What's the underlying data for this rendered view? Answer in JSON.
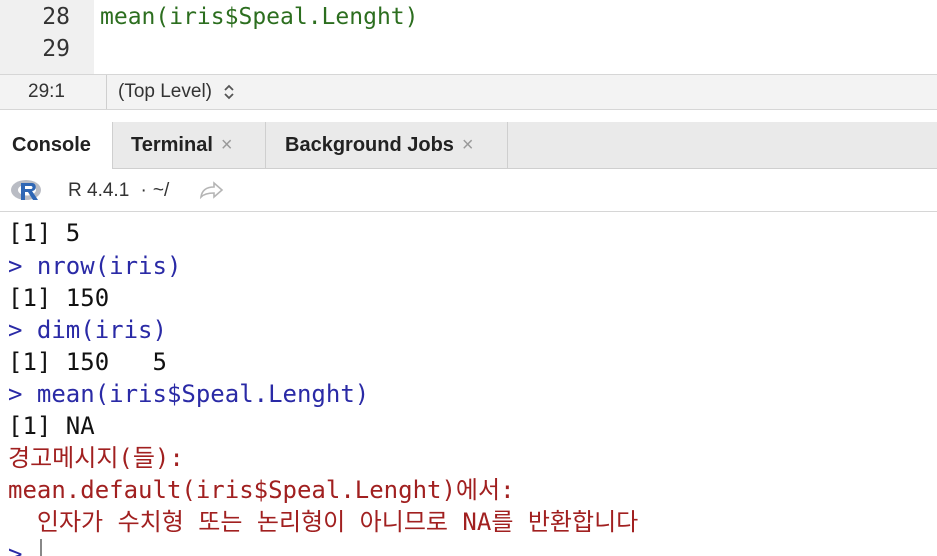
{
  "editor": {
    "lines": [
      {
        "number": "28",
        "code": "mean(iris$Speal.Lenght)"
      },
      {
        "number": "29",
        "code": ""
      }
    ]
  },
  "status": {
    "position": "29:1",
    "scope": "(Top Level)"
  },
  "tabs": [
    {
      "label": "Console",
      "closable": false,
      "active": true
    },
    {
      "label": "Terminal",
      "closable": true,
      "close": "×"
    },
    {
      "label": "Background Jobs",
      "closable": true,
      "close": "×"
    }
  ],
  "console_toolbar": {
    "r_version": "R 4.4.1",
    "separator": "·",
    "path": "~/"
  },
  "console": {
    "lines": [
      {
        "type": "out",
        "text": "[1] 5"
      },
      {
        "type": "cmd",
        "text": "> nrow(iris)"
      },
      {
        "type": "out",
        "text": "[1] 150"
      },
      {
        "type": "cmd",
        "text": "> dim(iris)"
      },
      {
        "type": "out",
        "text": "[1] 150   5"
      },
      {
        "type": "cmd",
        "text": "> mean(iris$Speal.Lenght)"
      },
      {
        "type": "out",
        "text": "[1] NA"
      },
      {
        "type": "err",
        "text": "경고메시지(들):"
      },
      {
        "type": "err",
        "text": "mean.default(iris$Speal.Lenght)에서:"
      },
      {
        "type": "err",
        "text": "  인자가 수치형 또는 논리형이 아니므로 NA를 반환합니다"
      },
      {
        "type": "cmd",
        "text": ">"
      }
    ]
  },
  "icons": {
    "r_logo": "r-logo-icon",
    "share": "share-arrow-icon",
    "scope_toggle": "up-down-arrows-icon"
  },
  "colors": {
    "command": "#2a2aa6",
    "error": "#a12020",
    "editor_code": "#2c6e1f"
  }
}
